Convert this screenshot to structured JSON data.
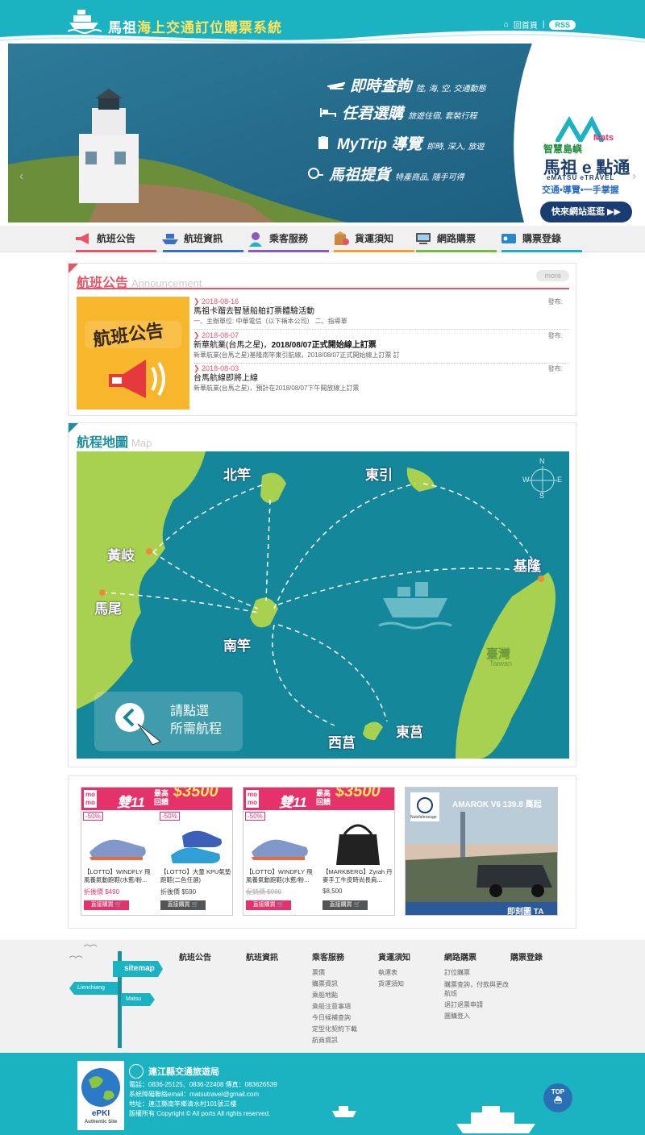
{
  "header": {
    "title_prefix": "馬祖",
    "title_suffix": "海上交通訂位購票系統",
    "home_label": "回首頁",
    "separator": "|",
    "rss_label": "RSS",
    "brand_color": "#1bb3c2"
  },
  "banner": {
    "items": [
      {
        "title": "即時查詢",
        "sub": "陸, 海, 空, 交通動態",
        "icon": "plane-icon"
      },
      {
        "title": "任君選購",
        "sub": "旅遊住宿, 套裝行程",
        "icon": "bed-icon"
      },
      {
        "title": "MyTrip 導覽",
        "sub": "即時, 深入, 旅遊",
        "icon": "clipboard-icon"
      },
      {
        "title": "馬祖提貨",
        "sub": "特產商品, 隨手可得",
        "icon": "delivery-icon"
      }
    ],
    "logo": {
      "brand_mark": "Mats",
      "line1": "智慧島嶼",
      "line2": "馬祖 e 點通",
      "line3": "eMATSU eTRAVEL",
      "line4": "交通•導覽•一手掌握"
    },
    "visit_button": "快來網站逛逛 ▶▶"
  },
  "nav": {
    "items": [
      {
        "label": "航班公告",
        "color": "#e85466",
        "icon": "megaphone-icon"
      },
      {
        "label": "航班資訊",
        "color": "#3a6fc4",
        "icon": "ship-icon"
      },
      {
        "label": "乘客服務",
        "color": "#8b5ab8",
        "icon": "service-agent-icon"
      },
      {
        "label": "貨運須知",
        "color": "#f0a030",
        "icon": "cargo-box-icon"
      },
      {
        "label": "網路購票",
        "color": "#6fbf3a",
        "icon": "computer-icon"
      },
      {
        "label": "購票登錄",
        "color": "#1bb3c2",
        "icon": "ticket-login-icon"
      }
    ]
  },
  "announcement": {
    "title": "航班公告",
    "title_en": "Announcement",
    "more": "more",
    "image_text": "航班公告",
    "items": [
      {
        "date": "2018-08-16",
        "title": "馬祖卡蹓去智慧船舶訂票體驗活動",
        "desc": "一、主辦單位: 中華電信（以下稱本公司） 二、指導單",
        "pub": "發布:"
      },
      {
        "date": "2018-08-07",
        "title_a": "新華航業(台馬之星)，",
        "title_b": "2018/08/07正式開始線上訂票",
        "desc": "新華航業(台馬之星)基隆南竿東引航線，2018/08/07正式開始線上訂票 訂",
        "pub": "發布:"
      },
      {
        "date": "2018-08-03",
        "title": "台馬航線即將上線",
        "desc": "新華航業(台馬之星)，預計在2018/08/07下午開放線上訂票",
        "pub": "發布:"
      }
    ]
  },
  "map": {
    "title": "航程地圖",
    "title_en": "Map",
    "labels": {
      "beigan": "北竿",
      "dongyin": "東引",
      "huangqi": "黃岐",
      "mawei": "馬尾",
      "keelung": "基隆",
      "nangan": "南竿",
      "xiju": "西莒",
      "dongju": "東莒",
      "taiwan": "臺灣",
      "taiwan_en": "Taiwan"
    },
    "compass": {
      "n": "N",
      "s": "S",
      "e": "E",
      "w": "W"
    },
    "prompt_line1": "請點選",
    "prompt_line2": "所需航程"
  },
  "ads": {
    "momo_logo_1": "mo",
    "momo_logo_2": "mo",
    "momo_title": "雙11",
    "momo_amount_top": "最高",
    "momo_amount_bottom": "回饋",
    "momo_amount": "$3500",
    "products_a": [
      {
        "off": "-50%",
        "name": "【LOTTO】WINDFLY 飛風養氣動跑鞋(水藍/粉...",
        "price": "折後價 $490",
        "buy": "直接購買 🛒"
      },
      {
        "off": "-50%",
        "name": "【LOTTO】大童 KPU氣墊跑鞋(二色任選)",
        "price": "折後價 $590",
        "buy": "直接購買 🛒"
      }
    ],
    "products_b": [
      {
        "off": "-50%",
        "name": "【LOTTO】WINDFLY 飛風養氣動跑鞋(水藍/粉...",
        "price": "促銷價 $980",
        "buy": "直接購買 🛒"
      },
      {
        "off": "",
        "name": "【MARKBERG】Zyrah 丹麥手工牛皮時尚長肩...",
        "price": "$8,500",
        "buy": "直接購買 🛒"
      }
    ],
    "vw": {
      "headline": "AMAROK V6 139.8 萬起",
      "brand": "Nutzfahrzeuge",
      "cta": "即刻圖 ТА"
    }
  },
  "footer": {
    "sitemap_sign": "sitemap",
    "sign_a": "Lienchiang",
    "sign_b": "Matsu",
    "cols": [
      {
        "h": "航班公告",
        "links": []
      },
      {
        "h": "航班資訊",
        "links": []
      },
      {
        "h": "乘客服務",
        "links": [
          "票價",
          "購票資訊",
          "乘船地點",
          "乘船注意事項",
          "今日候補查詢",
          "定型化契約下載",
          "航商資訊"
        ]
      },
      {
        "h": "貨運須知",
        "links": [
          "執運表",
          "貨運須知"
        ]
      },
      {
        "h": "網路購票",
        "links": [
          "訂位購票",
          "購票查詢，付款與更改航班",
          "退訂退票申請",
          "團購登入"
        ]
      },
      {
        "h": "購票登錄",
        "links": []
      }
    ]
  },
  "bottom": {
    "epki": "ePKI",
    "epki_sub": "Authentic Site",
    "org": "連江縣交通旅遊局",
    "phone": "電話：0836-25125、0836-22408 傳真：083626539",
    "email": "系統障礙聯絡email：matsutravel@gmail.com",
    "address": "地址：連江縣南竿鄉清水村101號三樓",
    "copyright": "版權所有 Copyright © All ports All rights reserved.",
    "top": "TOP"
  }
}
